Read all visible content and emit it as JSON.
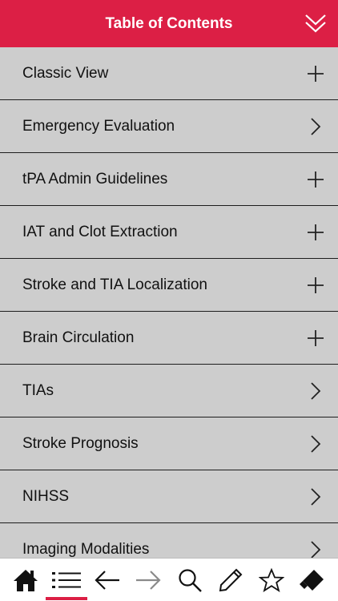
{
  "header": {
    "title": "Table of Contents"
  },
  "colors": {
    "accent": "#dc1f45",
    "row_background": "#cdcdcd",
    "divider": "#1d1d1d",
    "toolbar_background": "#ffffff",
    "disabled_icon": "#8a8a8a"
  },
  "items": [
    {
      "label": "Classic View",
      "icon": "plus-icon"
    },
    {
      "label": "Emergency Evaluation",
      "icon": "chevron-right-icon"
    },
    {
      "label": "tPA Admin Guidelines",
      "icon": "plus-icon"
    },
    {
      "label": "IAT and Clot Extraction",
      "icon": "plus-icon"
    },
    {
      "label": "Stroke and TIA Localization",
      "icon": "plus-icon"
    },
    {
      "label": "Brain Circulation",
      "icon": "plus-icon"
    },
    {
      "label": "TIAs",
      "icon": "chevron-right-icon"
    },
    {
      "label": "Stroke Prognosis",
      "icon": "chevron-right-icon"
    },
    {
      "label": "NIHSS",
      "icon": "chevron-right-icon"
    },
    {
      "label": "Imaging Modalities",
      "icon": "chevron-right-icon"
    }
  ],
  "toolbar": {
    "icons": [
      "home-icon",
      "list-icon",
      "arrow-left-icon",
      "arrow-right-icon",
      "search-icon",
      "pencil-icon",
      "star-icon",
      "eraser-icon"
    ],
    "active": "list-icon",
    "disabled": [
      "arrow-right-icon"
    ]
  }
}
